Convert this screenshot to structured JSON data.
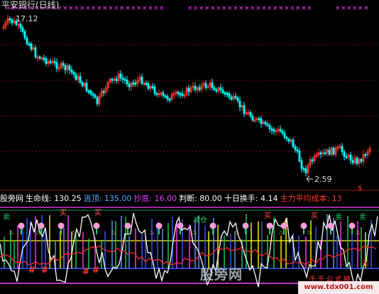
{
  "window": {
    "title": "平安银行(日线)",
    "high_label": "17.12",
    "low_label": "2.59"
  },
  "indicator": {
    "items": [
      {
        "label": "股旁网",
        "value": "",
        "color": "#ffffff"
      },
      {
        "label": "生命线:",
        "value": "130.25",
        "color": "#ffffff"
      },
      {
        "label": "逃顶:",
        "value": "135.00",
        "color": "#5da9ff"
      },
      {
        "label": "抄底:",
        "value": "16.00",
        "color": "#e040fb"
      },
      {
        "label": "判断:",
        "value": "80.00",
        "color": "#ffffff"
      },
      {
        "label": "十日换手:",
        "value": "4.14",
        "color": "#ffffff"
      },
      {
        "label": "主力平均成本:",
        "value": "13",
        "color": "#ff3b30"
      }
    ],
    "markers": {
      "buy": "买",
      "sell": "卖",
      "dump": "减仓",
      "mark": "$"
    }
  },
  "watermark": {
    "text": "股旁网",
    "site_top": "千千公式网",
    "site": "www.tdx001.com"
  },
  "colors": {
    "up": "#ff3b30",
    "down": "#00ffff",
    "cross": "#ff40ff",
    "yellow": "#ffff00",
    "magenta": "#ff40ff",
    "blue": "#3b5bff",
    "green": "#1fd16a",
    "white": "#ffffff",
    "grid": "#8b0000"
  }
}
